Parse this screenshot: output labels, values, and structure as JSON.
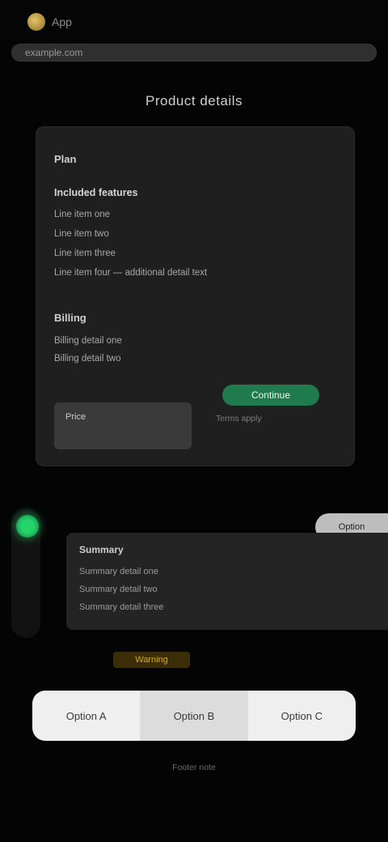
{
  "topbar": {
    "brand": "App"
  },
  "address": {
    "text": "example.com"
  },
  "main": {
    "heading": "Product details",
    "card": {
      "section1_title": "Plan",
      "feature_highlight": "Included features",
      "feature_lines": [
        "Line item one",
        "Line item two",
        "Line item three",
        "Line item four — additional detail text"
      ],
      "section2_title": "Billing",
      "billing_lines": [
        "Billing detail one",
        "Billing detail two"
      ],
      "price_box_label": "Price",
      "cta_label": "Continue",
      "note": "Terms apply"
    }
  },
  "lower": {
    "badge_label": "Option",
    "panel_title": "Summary",
    "panel_lines": [
      "Summary detail one",
      "Summary detail two",
      "Summary detail three"
    ],
    "warning": "Warning"
  },
  "segment": {
    "items": [
      "Option A",
      "Option B",
      "Option C"
    ],
    "active_index": 1
  },
  "footer": {
    "note": "Footer note"
  }
}
